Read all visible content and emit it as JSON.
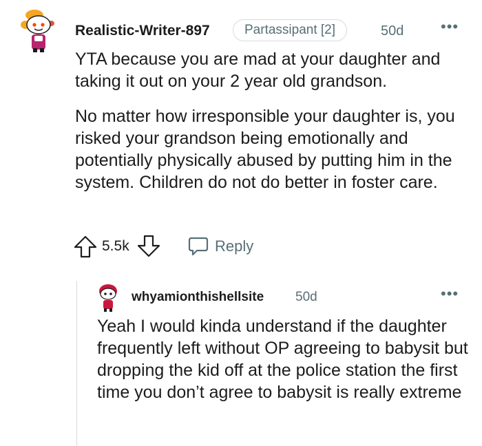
{
  "comment": {
    "username": "Realistic-Writer-897",
    "flair": "Partassipant [2]",
    "time": "50d",
    "more": "•••",
    "paragraphs": [
      "YTA because you are mad at your daughter and taking it out on your 2 year old grandson.",
      "No matter how irresponsible your daughter is, you risked your grandson being emotionally and potentially physically abused by putting him in the system. Children do not do better in foster care."
    ],
    "score": "5.5k",
    "reply_label": "Reply"
  },
  "reply": {
    "username": "whyamionthishellsite",
    "time": "50d",
    "more": "•••",
    "text": "Yeah I would kinda understand if the daughter frequently left without OP agreeing to babysit but dropping the kid off at the police station the first time you don’t agree to babysit is really extreme"
  },
  "icons": {
    "upvote": "upvote-icon",
    "downvote": "downvote-icon",
    "reply": "speech-bubble-icon",
    "more": "overflow-menu-icon"
  },
  "colors": {
    "text": "#1c1c1c",
    "meta": "#576f76",
    "border": "#d7dadc"
  }
}
